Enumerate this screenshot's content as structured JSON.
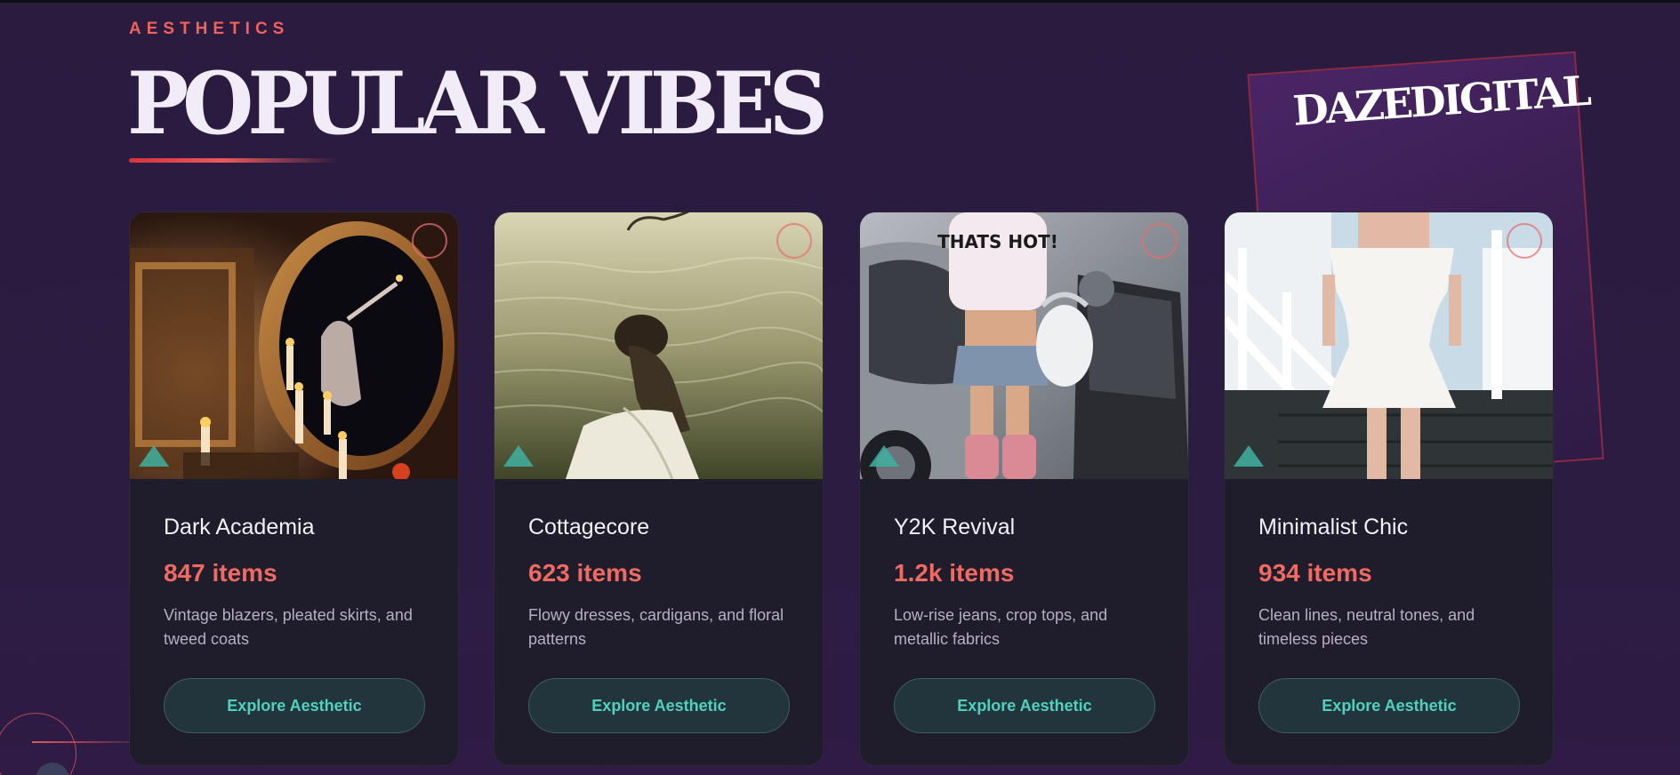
{
  "section": {
    "eyebrow": "AESTHETICS",
    "title": "POPULAR VIBES"
  },
  "brand": {
    "name": "DAZEDIGITAL"
  },
  "cards": [
    {
      "name": "Dark Academia",
      "count": "847 items",
      "description": "Vintage blazers, pleated skirts, and tweed coats",
      "button": "Explore Aesthetic"
    },
    {
      "name": "Cottagecore",
      "count": "623 items",
      "description": "Flowy dresses, cardigans, and floral patterns",
      "button": "Explore Aesthetic"
    },
    {
      "name": "Y2K Revival",
      "count": "1.2k items",
      "description": "Low-rise jeans, crop tops, and metallic fabrics",
      "button": "Explore Aesthetic"
    },
    {
      "name": "Minimalist Chic",
      "count": "934 items",
      "description": "Clean lines, neutral tones, and timeless pieces",
      "button": "Explore Aesthetic"
    }
  ],
  "photo_shirt_text": "THATS HOT!",
  "colors": {
    "background": "#2b1c41",
    "accent": "#f06a62",
    "teal": "#4fd1c0",
    "card": "#1f1c2c"
  }
}
